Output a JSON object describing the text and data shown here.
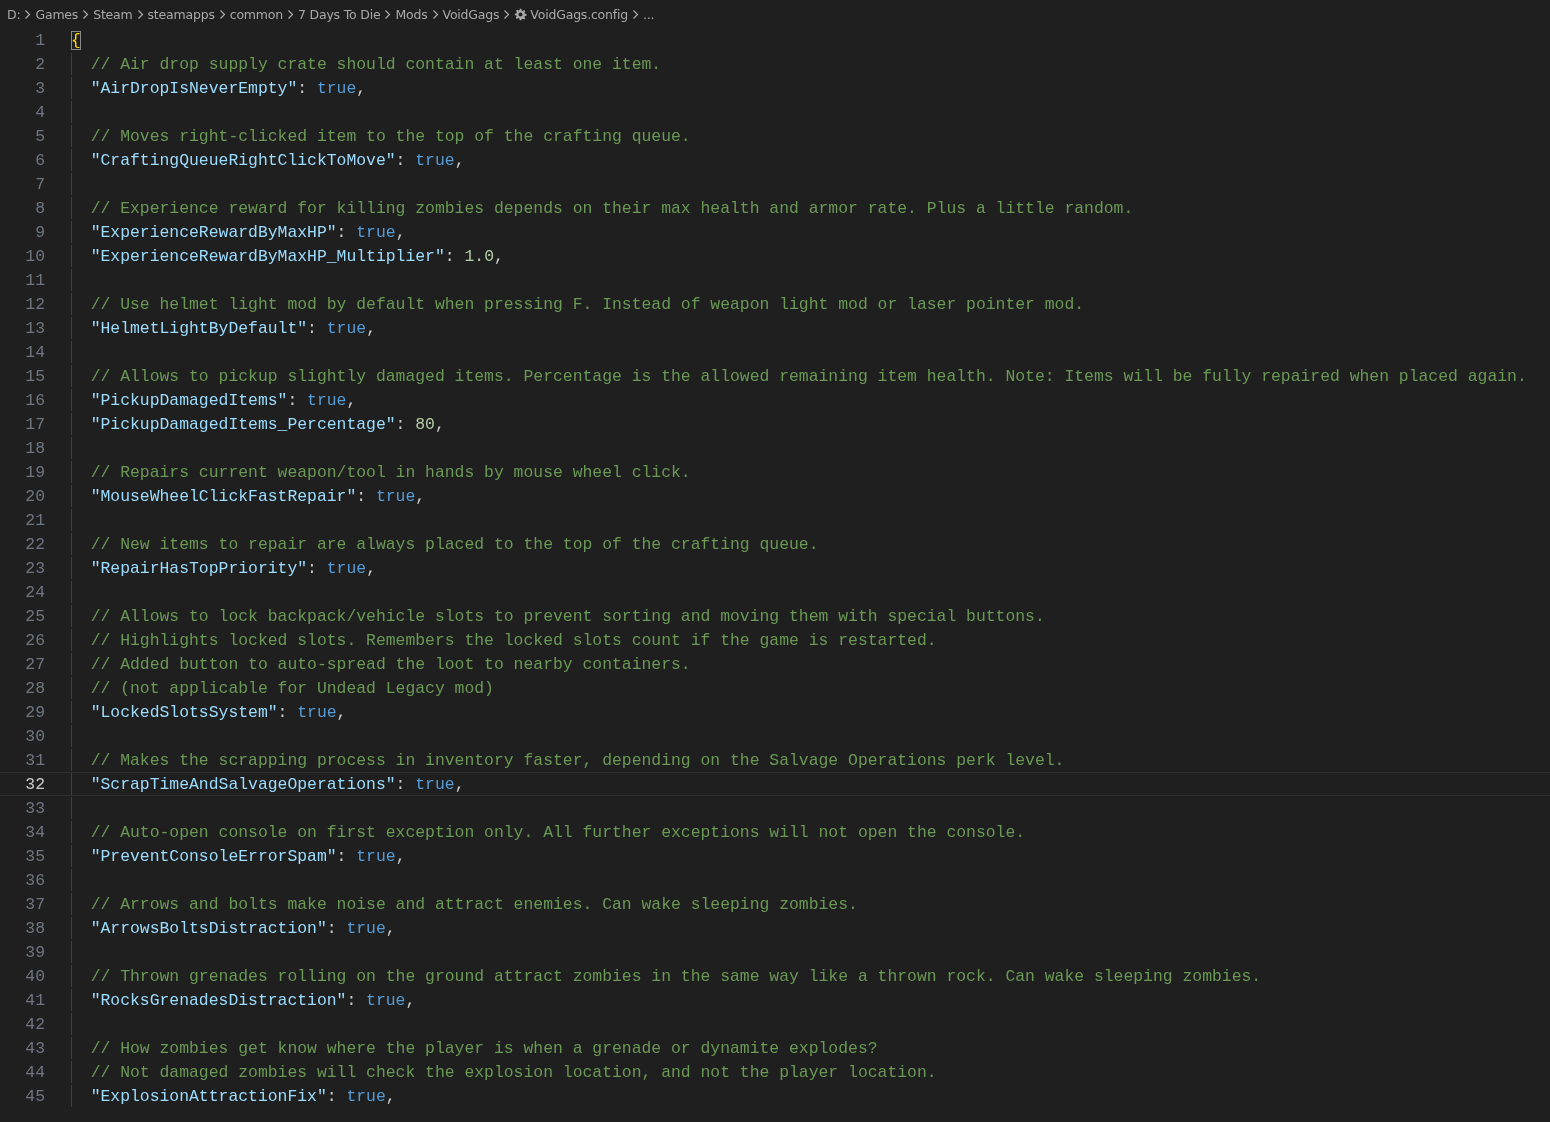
{
  "breadcrumb": [
    {
      "kind": "folder",
      "label": "D:"
    },
    {
      "kind": "folder",
      "label": "Games"
    },
    {
      "kind": "folder",
      "label": "Steam"
    },
    {
      "kind": "folder",
      "label": "steamapps"
    },
    {
      "kind": "folder",
      "label": "common"
    },
    {
      "kind": "folder",
      "label": "7 Days To Die"
    },
    {
      "kind": "folder",
      "label": "Mods"
    },
    {
      "kind": "folder",
      "label": "VoidGags"
    },
    {
      "kind": "settings-file",
      "label": "VoidGags.config"
    },
    {
      "kind": "more",
      "label": "..."
    }
  ],
  "editor": {
    "lines": [
      {
        "number": "1",
        "selected": false,
        "indented": false,
        "tokens": [
          {
            "kind": "brace-match",
            "text": "{"
          }
        ]
      },
      {
        "number": "2",
        "selected": false,
        "indented": true,
        "tokens": [
          {
            "kind": "comment",
            "text": "// Air drop supply crate should contain at least one item."
          }
        ]
      },
      {
        "number": "3",
        "selected": false,
        "indented": true,
        "tokens": [
          {
            "kind": "key",
            "text": "\"AirDropIsNeverEmpty\""
          },
          {
            "kind": "punct",
            "text": ": "
          },
          {
            "kind": "boolean",
            "text": "true"
          },
          {
            "kind": "punct",
            "text": ","
          }
        ]
      },
      {
        "number": "4",
        "selected": false,
        "indented": true
      },
      {
        "number": "5",
        "selected": false,
        "indented": true,
        "tokens": [
          {
            "kind": "comment",
            "text": "// Moves right-clicked item to the top of the crafting queue."
          }
        ]
      },
      {
        "number": "6",
        "selected": false,
        "indented": true,
        "tokens": [
          {
            "kind": "key",
            "text": "\"CraftingQueueRightClickToMove\""
          },
          {
            "kind": "punct",
            "text": ": "
          },
          {
            "kind": "boolean",
            "text": "true"
          },
          {
            "kind": "punct",
            "text": ","
          }
        ]
      },
      {
        "number": "7",
        "selected": false,
        "indented": true
      },
      {
        "number": "8",
        "selected": false,
        "indented": true,
        "tokens": [
          {
            "kind": "comment",
            "text": "// Experience reward for killing zombies depends on their max health and armor rate. Plus a little random."
          }
        ]
      },
      {
        "number": "9",
        "selected": false,
        "indented": true,
        "tokens": [
          {
            "kind": "key",
            "text": "\"ExperienceRewardByMaxHP\""
          },
          {
            "kind": "punct",
            "text": ": "
          },
          {
            "kind": "boolean",
            "text": "true"
          },
          {
            "kind": "punct",
            "text": ","
          }
        ]
      },
      {
        "number": "10",
        "selected": false,
        "indented": true,
        "tokens": [
          {
            "kind": "key",
            "text": "\"ExperienceRewardByMaxHP_Multiplier\""
          },
          {
            "kind": "punct",
            "text": ": "
          },
          {
            "kind": "number",
            "text": "1.0"
          },
          {
            "kind": "punct",
            "text": ","
          }
        ]
      },
      {
        "number": "11",
        "selected": false,
        "indented": true
      },
      {
        "number": "12",
        "selected": false,
        "indented": true,
        "tokens": [
          {
            "kind": "comment",
            "text": "// Use helmet light mod by default when pressing F. Instead of weapon light mod or laser pointer mod."
          }
        ]
      },
      {
        "number": "13",
        "selected": false,
        "indented": true,
        "tokens": [
          {
            "kind": "key",
            "text": "\"HelmetLightByDefault\""
          },
          {
            "kind": "punct",
            "text": ": "
          },
          {
            "kind": "boolean",
            "text": "true"
          },
          {
            "kind": "punct",
            "text": ","
          }
        ]
      },
      {
        "number": "14",
        "selected": false,
        "indented": true
      },
      {
        "number": "15",
        "selected": false,
        "indented": true,
        "tokens": [
          {
            "kind": "comment",
            "text": "// Allows to pickup slightly damaged items. Percentage is the allowed remaining item health. Note: Items will be fully repaired when placed again."
          }
        ]
      },
      {
        "number": "16",
        "selected": false,
        "indented": true,
        "tokens": [
          {
            "kind": "key",
            "text": "\"PickupDamagedItems\""
          },
          {
            "kind": "punct",
            "text": ": "
          },
          {
            "kind": "boolean",
            "text": "true"
          },
          {
            "kind": "punct",
            "text": ","
          }
        ]
      },
      {
        "number": "17",
        "selected": false,
        "indented": true,
        "tokens": [
          {
            "kind": "key",
            "text": "\"PickupDamagedItems_Percentage\""
          },
          {
            "kind": "punct",
            "text": ": "
          },
          {
            "kind": "number",
            "text": "80"
          },
          {
            "kind": "punct",
            "text": ","
          }
        ]
      },
      {
        "number": "18",
        "selected": false,
        "indented": true
      },
      {
        "number": "19",
        "selected": false,
        "indented": true,
        "tokens": [
          {
            "kind": "comment",
            "text": "// Repairs current weapon/tool in hands by mouse wheel click."
          }
        ]
      },
      {
        "number": "20",
        "selected": false,
        "indented": true,
        "tokens": [
          {
            "kind": "key",
            "text": "\"MouseWheelClickFastRepair\""
          },
          {
            "kind": "punct",
            "text": ": "
          },
          {
            "kind": "boolean",
            "text": "true"
          },
          {
            "kind": "punct",
            "text": ","
          }
        ]
      },
      {
        "number": "21",
        "selected": false,
        "indented": true
      },
      {
        "number": "22",
        "selected": false,
        "indented": true,
        "tokens": [
          {
            "kind": "comment",
            "text": "// New items to repair are always placed to the top of the crafting queue."
          }
        ]
      },
      {
        "number": "23",
        "selected": false,
        "indented": true,
        "tokens": [
          {
            "kind": "key",
            "text": "\"RepairHasTopPriority\""
          },
          {
            "kind": "punct",
            "text": ": "
          },
          {
            "kind": "boolean",
            "text": "true"
          },
          {
            "kind": "punct",
            "text": ","
          }
        ]
      },
      {
        "number": "24",
        "selected": false,
        "indented": true
      },
      {
        "number": "25",
        "selected": false,
        "indented": true,
        "tokens": [
          {
            "kind": "comment",
            "text": "// Allows to lock backpack/vehicle slots to prevent sorting and moving them with special buttons."
          }
        ]
      },
      {
        "number": "26",
        "selected": false,
        "indented": true,
        "tokens": [
          {
            "kind": "comment",
            "text": "// Highlights locked slots. Remembers the locked slots count if the game is restarted."
          }
        ]
      },
      {
        "number": "27",
        "selected": false,
        "indented": true,
        "tokens": [
          {
            "kind": "comment",
            "text": "// Added button to auto-spread the loot to nearby containers."
          }
        ]
      },
      {
        "number": "28",
        "selected": false,
        "indented": true,
        "tokens": [
          {
            "kind": "comment",
            "text": "// (not applicable for Undead Legacy mod)"
          }
        ]
      },
      {
        "number": "29",
        "selected": false,
        "indented": true,
        "tokens": [
          {
            "kind": "key",
            "text": "\"LockedSlotsSystem\""
          },
          {
            "kind": "punct",
            "text": ": "
          },
          {
            "kind": "boolean",
            "text": "true"
          },
          {
            "kind": "punct",
            "text": ","
          }
        ]
      },
      {
        "number": "30",
        "selected": false,
        "indented": true
      },
      {
        "number": "31",
        "selected": false,
        "indented": true,
        "tokens": [
          {
            "kind": "comment",
            "text": "// Makes the scrapping process in inventory faster, depending on the Salvage Operations perk level."
          }
        ]
      },
      {
        "number": "32",
        "selected": true,
        "indented": true,
        "tokens": [
          {
            "kind": "key",
            "text": "\"ScrapTimeAndSalvageOperations\""
          },
          {
            "kind": "punct",
            "text": ": "
          },
          {
            "kind": "boolean",
            "text": "true"
          },
          {
            "kind": "punct",
            "text": ","
          }
        ]
      },
      {
        "number": "33",
        "selected": false,
        "indented": true
      },
      {
        "number": "34",
        "selected": false,
        "indented": true,
        "tokens": [
          {
            "kind": "comment",
            "text": "// Auto-open console on first exception only. All further exceptions will not open the console."
          }
        ]
      },
      {
        "number": "35",
        "selected": false,
        "indented": true,
        "tokens": [
          {
            "kind": "key",
            "text": "\"PreventConsoleErrorSpam\""
          },
          {
            "kind": "punct",
            "text": ": "
          },
          {
            "kind": "boolean",
            "text": "true"
          },
          {
            "kind": "punct",
            "text": ","
          }
        ]
      },
      {
        "number": "36",
        "selected": false,
        "indented": true
      },
      {
        "number": "37",
        "selected": false,
        "indented": true,
        "tokens": [
          {
            "kind": "comment",
            "text": "// Arrows and bolts make noise and attract enemies. Can wake sleeping zombies."
          }
        ]
      },
      {
        "number": "38",
        "selected": false,
        "indented": true,
        "tokens": [
          {
            "kind": "key",
            "text": "\"ArrowsBoltsDistraction\""
          },
          {
            "kind": "punct",
            "text": ": "
          },
          {
            "kind": "boolean",
            "text": "true"
          },
          {
            "kind": "punct",
            "text": ","
          }
        ]
      },
      {
        "number": "39",
        "selected": false,
        "indented": true
      },
      {
        "number": "40",
        "selected": false,
        "indented": true,
        "tokens": [
          {
            "kind": "comment",
            "text": "// Thrown grenades rolling on the ground attract zombies in the same way like a thrown rock. Can wake sleeping zombies."
          }
        ]
      },
      {
        "number": "41",
        "selected": false,
        "indented": true,
        "tokens": [
          {
            "kind": "key",
            "text": "\"RocksGrenadesDistraction\""
          },
          {
            "kind": "punct",
            "text": ": "
          },
          {
            "kind": "boolean",
            "text": "true"
          },
          {
            "kind": "punct",
            "text": ","
          }
        ]
      },
      {
        "number": "42",
        "selected": false,
        "indented": true
      },
      {
        "number": "43",
        "selected": false,
        "indented": true,
        "tokens": [
          {
            "kind": "comment",
            "text": "// How zombies get know where the player is when a grenade or dynamite explodes?"
          }
        ]
      },
      {
        "number": "44",
        "selected": false,
        "indented": true,
        "tokens": [
          {
            "kind": "comment",
            "text": "// Not damaged zombies will check the explosion location, and not the player location."
          }
        ]
      },
      {
        "number": "45",
        "selected": false,
        "indented": true,
        "tokens": [
          {
            "kind": "key",
            "text": "\"ExplosionAttractionFix\""
          },
          {
            "kind": "punct",
            "text": ": "
          },
          {
            "kind": "boolean",
            "text": "true"
          },
          {
            "kind": "punct",
            "text": ","
          }
        ]
      }
    ]
  }
}
